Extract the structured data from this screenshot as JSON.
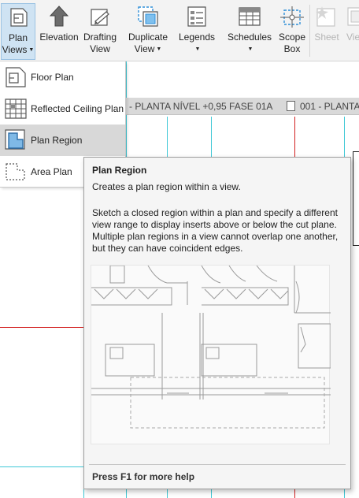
{
  "ribbon": {
    "plan_views": {
      "line1": "Plan",
      "line2": "Views",
      "icon": "plan-views-icon"
    },
    "elevation": {
      "label": "Elevation",
      "icon": "elevation-icon"
    },
    "drafting_view": {
      "line1": "Drafting",
      "line2": "View",
      "icon": "drafting-view-icon"
    },
    "duplicate_view": {
      "line1": "Duplicate",
      "line2": "View",
      "icon": "duplicate-view-icon"
    },
    "legends": {
      "label": "Legends",
      "icon": "legends-icon"
    },
    "schedules": {
      "label": "Schedules",
      "icon": "schedules-icon"
    },
    "scope_box": {
      "line1": "Scope",
      "line2": "Box",
      "icon": "scope-box-icon"
    },
    "sheet": {
      "label": "Sheet",
      "icon": "sheet-icon"
    },
    "view_partial": {
      "label": "Vie",
      "icon": "view-icon"
    }
  },
  "tabs": [
    {
      "label": "- PLANTA NÍVEL +0,95 FASE 01A"
    },
    {
      "label": "001 - PLANTA"
    }
  ],
  "dropdown": {
    "items": [
      {
        "label": "Floor Plan",
        "icon": "floor-plan-icon"
      },
      {
        "label": "Reflected Ceiling Plan",
        "icon": "reflected-ceiling-plan-icon"
      },
      {
        "label": "Plan Region",
        "icon": "plan-region-icon",
        "selected": true
      },
      {
        "label": "Area Plan",
        "icon": "area-plan-icon"
      }
    ]
  },
  "tooltip": {
    "title": "Plan Region",
    "subtitle": "Creates a plan region within a view.",
    "body": "Sketch a closed region within a plan and specify a different view range to display inserts above or below the cut plane. Multiple plan regions in a view cannot overlap one another, but they can have coincident edges.",
    "footer": "Press F1 for more help"
  },
  "colors": {
    "cut_line": "#d21f1f",
    "guide_line": "#3fc8d6",
    "ribbon_bg": "#f3f3f3",
    "selected_bg": "#d8d8d8",
    "icon_blue": "#2f8fd8"
  }
}
